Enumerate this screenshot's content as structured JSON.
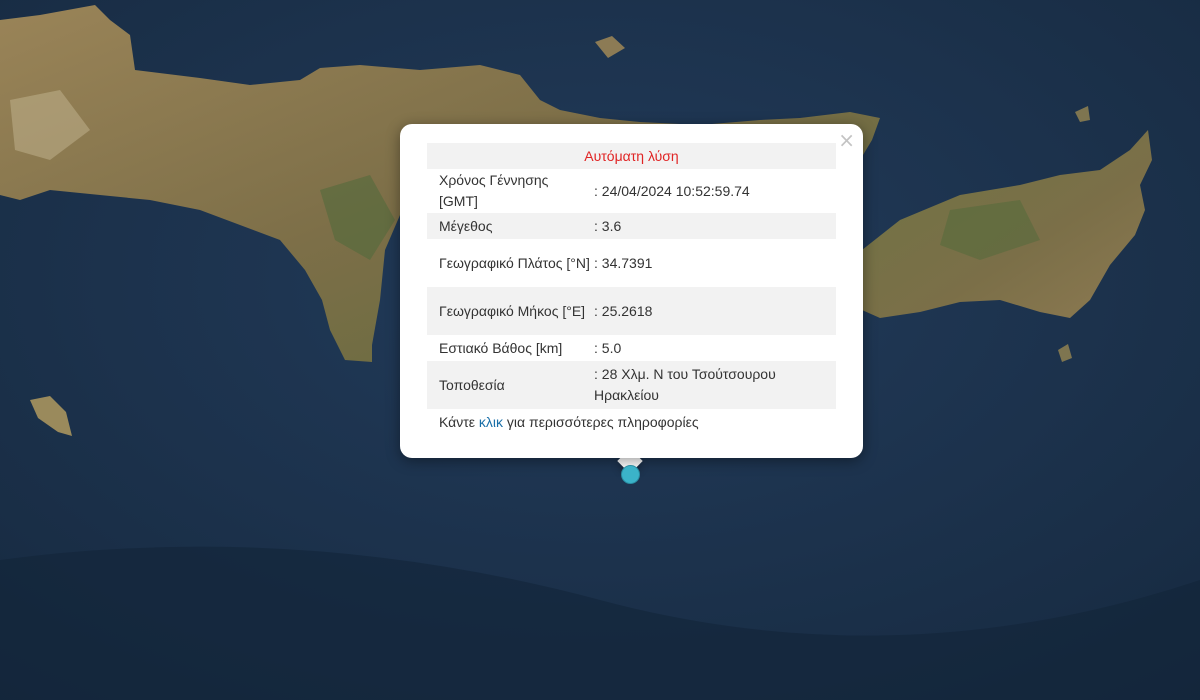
{
  "popup": {
    "close_label": "×",
    "status": "Αυτόματη λύση",
    "rows": [
      {
        "label": "Χρόνος Γέννησης [GMT]",
        "value": ": 24/04/2024 10:52:59.74"
      },
      {
        "label": "Μέγεθος",
        "value": ": 3.6"
      },
      {
        "label": "Γεωγραφικό Πλάτος [°N]",
        "value": ": 34.7391"
      },
      {
        "label": "Γεωγραφικό Μήκος [°E]",
        "value": ": 25.2618"
      },
      {
        "label": "Εστιακό Βάθος [km]",
        "value": ": 5.0"
      },
      {
        "label": "Τοποθεσία",
        "value": ": 28 Χλμ. Ν του Τσούτσουρου Ηρακλείου"
      }
    ],
    "more_before": "Κάντε ",
    "more_link": "κλικ",
    "more_after": " για περισσότερες πληροφορίες"
  },
  "colors": {
    "sea": "#1b3350",
    "land": "#8a7a52",
    "marker": "#3bb3c9",
    "status_text": "#e02424",
    "link": "#1a6fa8"
  },
  "icons": {
    "close": "close-icon",
    "marker": "earthquake-marker"
  }
}
